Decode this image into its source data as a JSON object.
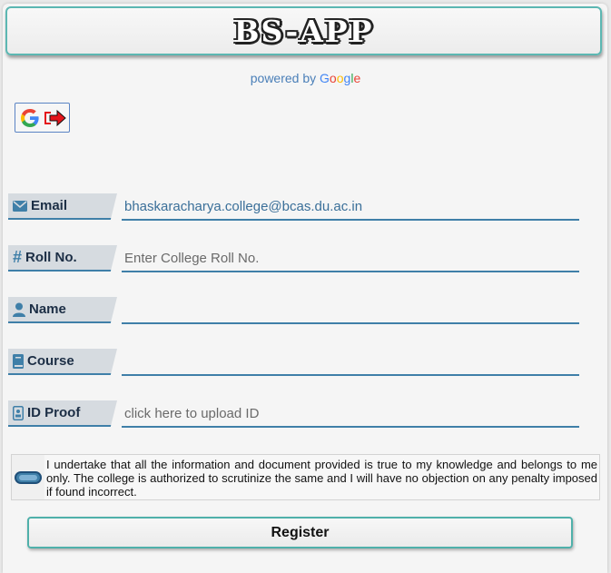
{
  "app": {
    "title": "BS-APP"
  },
  "powered": {
    "prefix": "powered by ",
    "brand": [
      "G",
      "o",
      "o",
      "g",
      "l",
      "e"
    ],
    "brand_colors": [
      "#4285F4",
      "#EA4335",
      "#FBBC05",
      "#4285F4",
      "#34A853",
      "#EA4335"
    ]
  },
  "google_signout": {
    "icons": [
      "google-g-icon",
      "sign-out-icon"
    ]
  },
  "form": {
    "fields": [
      {
        "label": "Email",
        "icon": "envelope-icon",
        "value": "bhaskaracharya.college@bcas.du.ac.in",
        "placeholder": ""
      },
      {
        "label": "Roll No.",
        "icon": "hash-icon",
        "value": "",
        "placeholder": "Enter College Roll No."
      },
      {
        "label": "Name",
        "icon": "user-icon",
        "value": "",
        "placeholder": ""
      },
      {
        "label": "Course",
        "icon": "book-icon",
        "value": "",
        "placeholder": ""
      },
      {
        "label": "ID Proof",
        "icon": "id-card-icon",
        "value": "",
        "placeholder": "click here to upload ID"
      }
    ],
    "declaration": "I undertake that all the information and document provided is true to my knowledge and belongs to me only. The college is authorized to scrutinize the same and I will have no objection on any penalty imposed if found incorrect.",
    "declaration_toggle_checked": true,
    "register_label": "Register"
  },
  "colors": {
    "accent": "#3f7fa8",
    "header_border": "#5cb7b2",
    "label_bg": "#d6dbe0"
  }
}
